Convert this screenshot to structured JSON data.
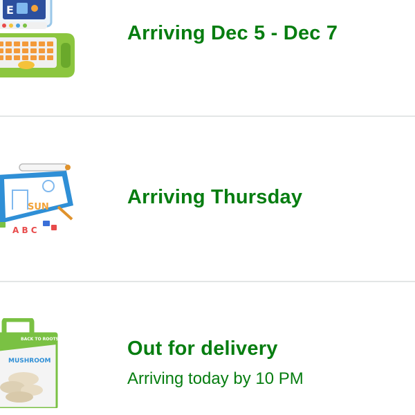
{
  "orders": [
    {
      "product_icon": "kids-learning-laptop-toy",
      "status": "Arriving Dec 5 - Dec 7",
      "detail": ""
    },
    {
      "product_icon": "tabletop-easel-with-magnets",
      "status": "Arriving Thursday",
      "detail": ""
    },
    {
      "product_icon": "mushroom-grow-kit-box",
      "status": "Out for delivery",
      "detail": "Arriving today by 10 PM"
    }
  ],
  "product_art": {
    "laptop_screen_letter": "E",
    "easel_word": "SUN",
    "easel_magnets": "A B C",
    "kit_brand": "BACK TO ROOTS",
    "kit_label": "MUSHROOM"
  },
  "colors": {
    "status_green": "#067d10",
    "divider": "#e3e6e6",
    "background": "#ffffff"
  }
}
